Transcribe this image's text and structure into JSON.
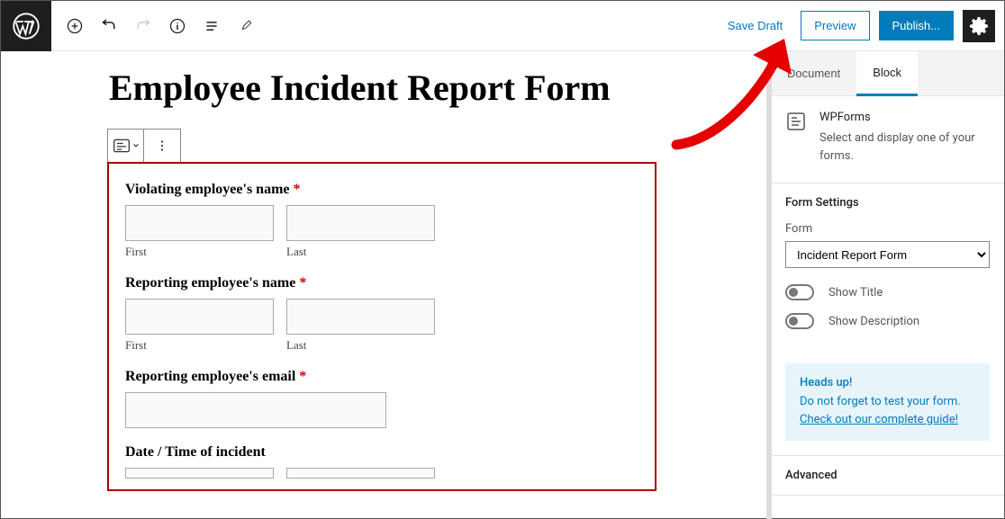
{
  "toolbar": {
    "save_draft": "Save Draft",
    "preview": "Preview",
    "publish": "Publish..."
  },
  "editor": {
    "title": "Employee Incident Report Form"
  },
  "form": {
    "fields": {
      "violating_name": {
        "label": "Violating employee's name",
        "required": "*",
        "first_sublabel": "First",
        "last_sublabel": "Last"
      },
      "reporting_name": {
        "label": "Reporting employee's name",
        "required": "*",
        "first_sublabel": "First",
        "last_sublabel": "Last"
      },
      "reporting_email": {
        "label": "Reporting employee's email",
        "required": "*"
      },
      "datetime": {
        "label": "Date / Time of incident"
      }
    }
  },
  "sidebar": {
    "tabs": {
      "document": "Document",
      "block": "Block"
    },
    "block_info": {
      "title": "WPForms",
      "desc": "Select and display one of your forms."
    },
    "form_settings": {
      "header": "Form Settings",
      "form_label": "Form",
      "form_selected": "Incident Report Form",
      "show_title": "Show Title",
      "show_description": "Show Description"
    },
    "notice": {
      "title": "Heads up!",
      "text": "Do not forget to test your form.",
      "link": "Check out our complete guide!"
    },
    "advanced": {
      "header": "Advanced"
    }
  }
}
